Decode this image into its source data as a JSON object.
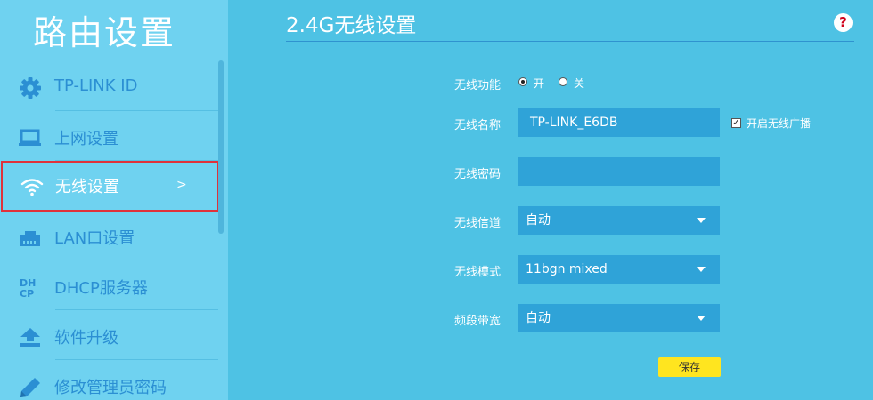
{
  "app_title": "路由设置",
  "sidebar": {
    "items": [
      {
        "label": "TP-LINK ID",
        "icon": "gear-icon"
      },
      {
        "label": "上网设置",
        "icon": "laptop-icon"
      },
      {
        "label": "无线设置",
        "icon": "wifi-icon",
        "active": true,
        "arrow": ">"
      },
      {
        "label": "LAN口设置",
        "icon": "lan-port-icon"
      },
      {
        "label": "DHCP服务器",
        "icon": "dhcp-icon",
        "icon_text_top": "DH",
        "icon_text_bottom": "CP"
      },
      {
        "label": "软件升级",
        "icon": "upload-icon"
      },
      {
        "label": "修改管理员密码",
        "icon": "pencil-icon"
      }
    ]
  },
  "main": {
    "section_title": "2.4G无线设置",
    "help_symbol": "?",
    "wireless_function": {
      "label": "无线功能",
      "on_label": "开",
      "off_label": "关",
      "selected": "开"
    },
    "wireless_name": {
      "label": "无线名称",
      "value": "TP-LINK_E6DB",
      "broadcast_label": "开启无线广播",
      "broadcast_checked": true
    },
    "wireless_password": {
      "label": "无线密码",
      "value": ""
    },
    "wireless_channel": {
      "label": "无线信道",
      "value": "自动"
    },
    "wireless_mode": {
      "label": "无线模式",
      "value": "11bgn mixed"
    },
    "bandwidth": {
      "label": "频段带宽",
      "value": "自动"
    },
    "save_label": "保存"
  },
  "colors": {
    "main_background": "#4ec2e4",
    "sidebar_background": "#6fd2f0",
    "nav_text": "#2b8fd3",
    "active_border": "#e0323b",
    "input_background": "#2fa3d8",
    "save_button": "#ffe51f"
  }
}
